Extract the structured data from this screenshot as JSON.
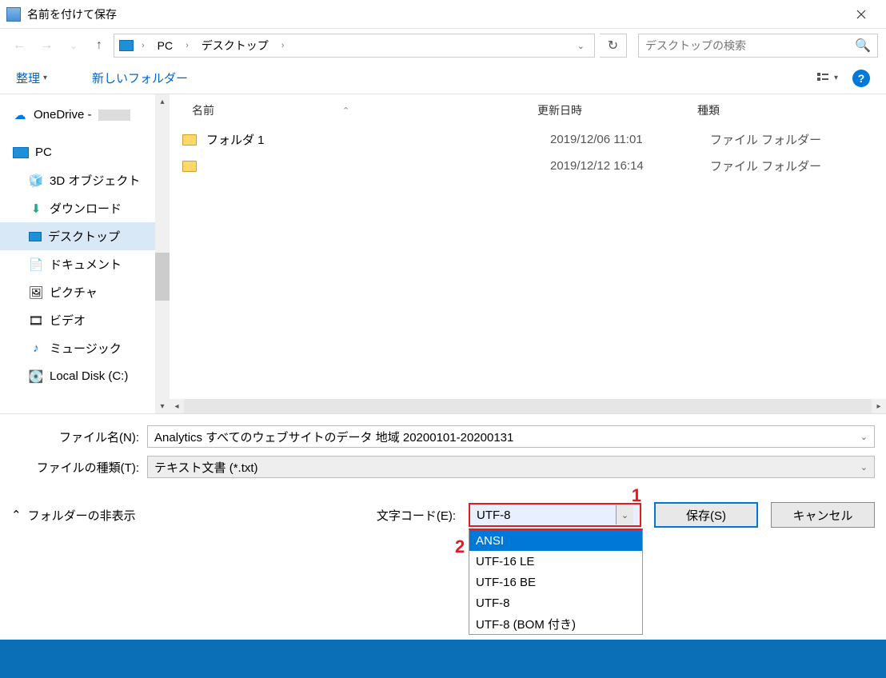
{
  "window": {
    "title": "名前を付けて保存"
  },
  "breadcrumb": {
    "pc": "PC",
    "desktop": "デスクトップ"
  },
  "search": {
    "placeholder": "デスクトップの検索"
  },
  "toolbar": {
    "organize": "整理",
    "newfolder": "新しいフォルダー"
  },
  "sidebar": {
    "onedrive": "OneDrive -",
    "pc": "PC",
    "items": [
      "3D オブジェクト",
      "ダウンロード",
      "デスクトップ",
      "ドキュメント",
      "ピクチャ",
      "ビデオ",
      "ミュージック",
      "Local Disk (C:)"
    ]
  },
  "columns": {
    "name": "名前",
    "date": "更新日時",
    "type": "種類"
  },
  "files": [
    {
      "name": "フォルダ 1",
      "date": "2019/12/06 11:01",
      "type": "ファイル フォルダー"
    },
    {
      "name": "",
      "date": "2019/12/12 16:14",
      "type": "ファイル フォルダー"
    }
  ],
  "form": {
    "filename_label": "ファイル名(N):",
    "filename_value": "Analytics すべてのウェブサイトのデータ 地域 20200101-20200131",
    "filetype_label": "ファイルの種類(T):",
    "filetype_value": "テキスト文書 (*.txt)"
  },
  "bottom": {
    "hide_folders": "フォルダーの非表示",
    "encoding_label": "文字コード(E):",
    "encoding_value": "UTF-8",
    "save": "保存(S)",
    "cancel": "キャンセル"
  },
  "encoding_options": [
    "ANSI",
    "UTF-16 LE",
    "UTF-16 BE",
    "UTF-8",
    "UTF-8 (BOM 付き)"
  ],
  "annotations": {
    "one": "1",
    "two": "2"
  }
}
